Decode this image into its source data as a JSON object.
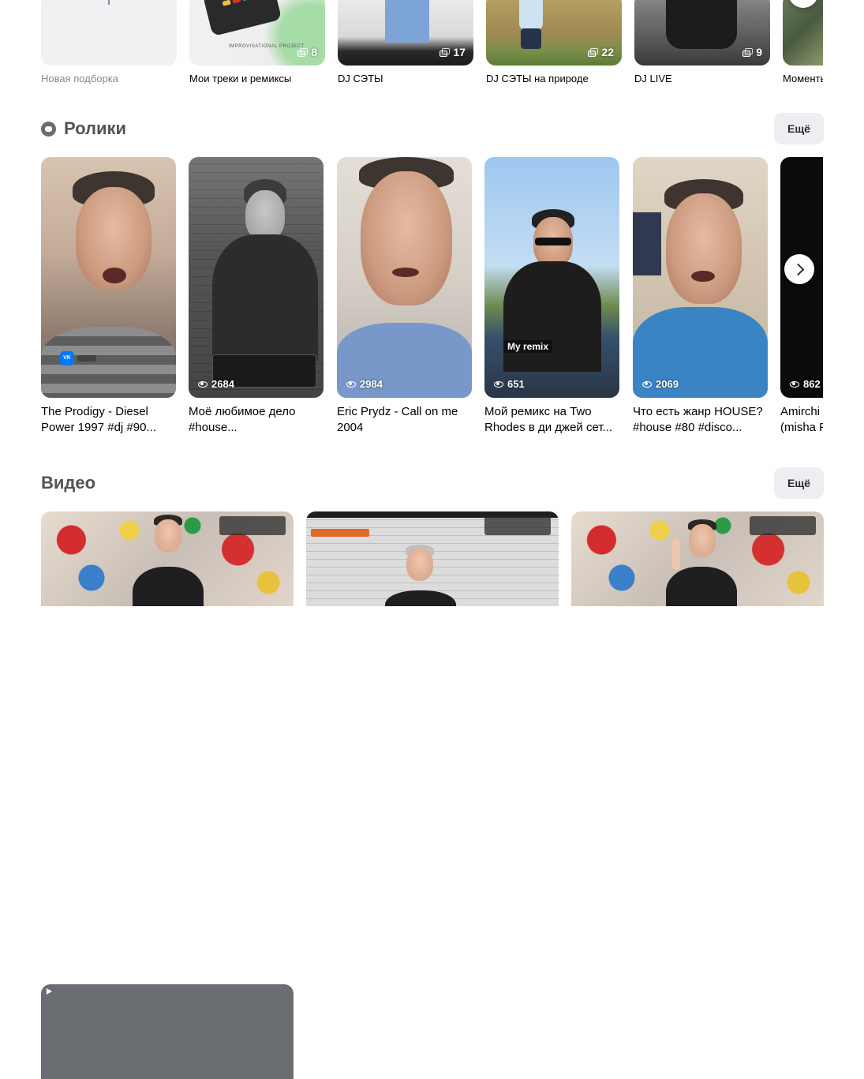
{
  "albums": [
    {
      "label": "Новая подборка",
      "count": ""
    },
    {
      "label": "Мои треки и ремиксы",
      "count": "8",
      "image_text": "IMPROVISATIONAL PROJECT"
    },
    {
      "label": "DJ СЭТЫ",
      "count": "17"
    },
    {
      "label": "DJ СЭТЫ на природе",
      "count": "22"
    },
    {
      "label": "DJ LIVE",
      "count": "9"
    },
    {
      "label": "Моменты",
      "count": ""
    }
  ],
  "clips_section": {
    "title": "Ролики",
    "more_label": "Ещё",
    "items": [
      {
        "title": "The Prodigy - Diesel Power 1997 #dj #90...",
        "views": "",
        "overlay_text": "VK"
      },
      {
        "title": "Моё любимое дело #house...",
        "views": "2684"
      },
      {
        "title": "Eric Prydz - Call on me 2004",
        "views": "2984"
      },
      {
        "title": "Мой ремикс на Two Rhodes в ди джей сет...",
        "views": "651",
        "overlay_text": "My remix"
      },
      {
        "title": "Что есть жанр HOUSE? #house #80 #disco...",
        "views": "2069"
      },
      {
        "title": "Amirchi (misha F",
        "views": "862"
      }
    ]
  },
  "videos_section": {
    "title": "Видео",
    "more_label": "Ещё"
  },
  "icons": {
    "clips_icon": "clips-icon",
    "video_icon": "video-play-icon",
    "eye_icon": "eye-icon",
    "stack_icon": "stack-icon",
    "next_icon": "chevron-right-icon"
  }
}
